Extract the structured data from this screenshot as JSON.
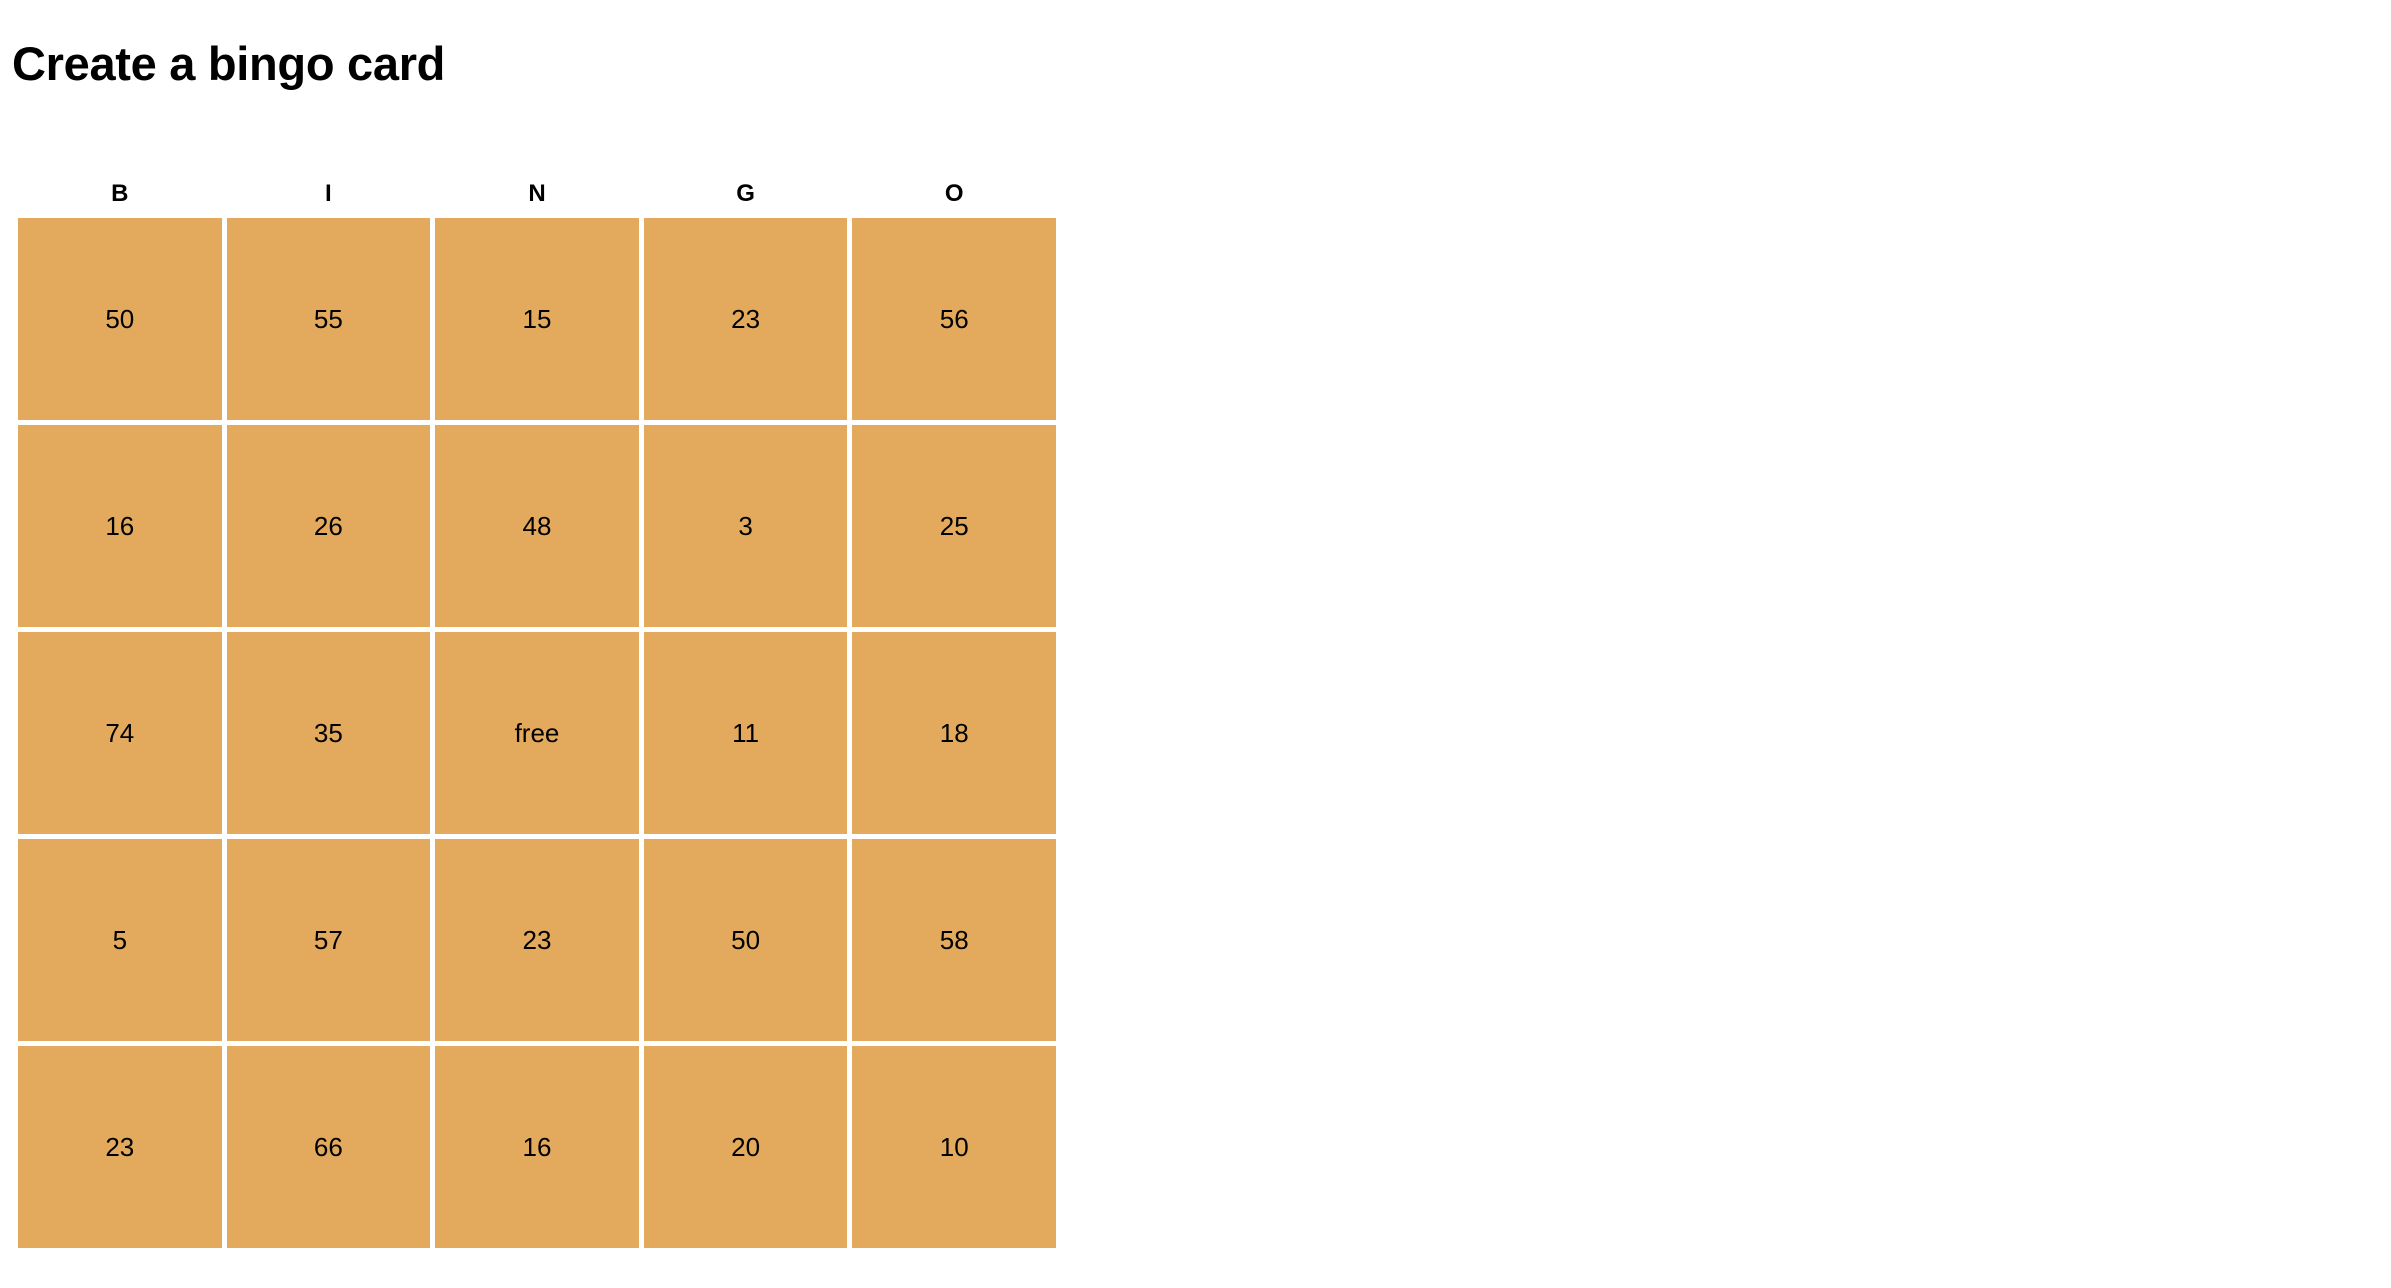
{
  "page": {
    "title": "Create a bingo card",
    "background_color": "#ffffff"
  },
  "bingo": {
    "cell_color": "#e3aa5e",
    "text_color": "#000000",
    "gap_color": "#ffffff",
    "columns": [
      "B",
      "I",
      "N",
      "G",
      "O"
    ],
    "rows": [
      [
        "50",
        "55",
        "15",
        "23",
        "56"
      ],
      [
        "16",
        "26",
        "48",
        "3",
        "25"
      ],
      [
        "74",
        "35",
        "free",
        "11",
        "18"
      ],
      [
        "5",
        "57",
        "23",
        "50",
        "58"
      ],
      [
        "23",
        "66",
        "16",
        "20",
        "10"
      ]
    ],
    "free_space": {
      "row": 2,
      "col": 2,
      "label": "free"
    }
  }
}
